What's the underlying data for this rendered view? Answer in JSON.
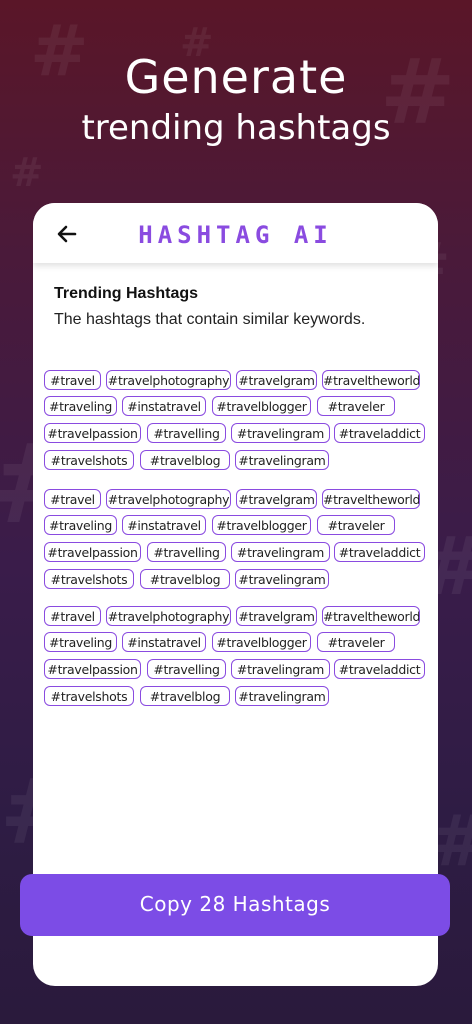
{
  "headline": {
    "line1": "Generate",
    "line2": "trending hashtags"
  },
  "app": {
    "title": "HASHTAG AI",
    "back_icon": "arrow-left-icon"
  },
  "section": {
    "title": "Trending Hashtags",
    "subtitle": "The hashtags that contain similar keywords."
  },
  "groups": [
    {
      "rows": [
        [
          "#travel",
          "#travelphotography",
          "#travelgram",
          "#traveltheworld"
        ],
        [
          "#traveling",
          "#instatravel",
          "#travelblogger",
          "#traveler"
        ],
        [
          "#travelpassion",
          "#travelling",
          "#travelingram",
          "#traveladdict"
        ],
        [
          "#travelshots",
          "#travelblog",
          "#travelingram"
        ]
      ]
    },
    {
      "rows": [
        [
          "#travel",
          "#travelphotography",
          "#travelgram",
          "#traveltheworld"
        ],
        [
          "#traveling",
          "#instatravel",
          "#travelblogger",
          "#traveler"
        ],
        [
          "#travelpassion",
          "#travelling",
          "#travelingram",
          "#traveladdict"
        ],
        [
          "#travelshots",
          "#travelblog",
          "#travelingram"
        ]
      ]
    },
    {
      "rows": [
        [
          "#travel",
          "#travelphotography",
          "#travelgram",
          "#traveltheworld"
        ],
        [
          "#traveling",
          "#instatravel",
          "#travelblogger",
          "#traveler"
        ],
        [
          "#travelpassion",
          "#travelling",
          "#travelingram",
          "#traveladdict"
        ],
        [
          "#travelshots",
          "#travelblog",
          "#travelingram"
        ]
      ]
    }
  ],
  "copy_button": {
    "label": "Copy 28 Hashtags"
  },
  "colors": {
    "accent": "#8a4be0",
    "button": "#7c4ce6"
  }
}
